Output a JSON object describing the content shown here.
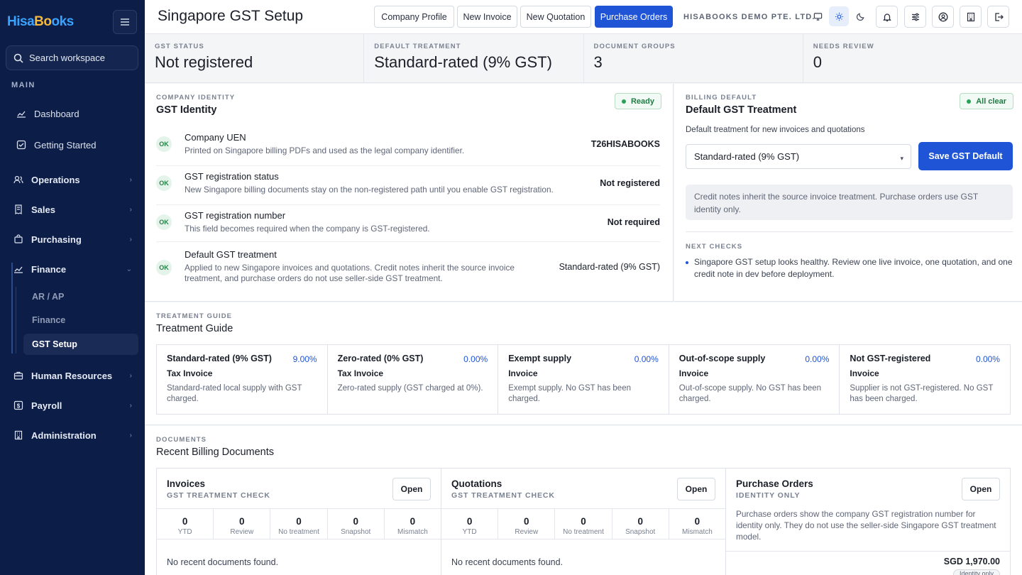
{
  "sidebar": {
    "logo_a": "Hisa",
    "logo_b": "Bo",
    "logo_c": "oks",
    "search_placeholder": "Search workspace",
    "section_main": "MAIN",
    "top_items": [
      {
        "label": "Dashboard",
        "icon": "chart-line-icon"
      },
      {
        "label": "Getting Started",
        "icon": "checkbox-icon"
      }
    ],
    "groups": [
      {
        "label": "Operations",
        "icon": "users-icon"
      },
      {
        "label": "Sales",
        "icon": "receipt-icon"
      },
      {
        "label": "Purchasing",
        "icon": "cart-icon"
      },
      {
        "label": "Finance",
        "icon": "chart-line-icon"
      },
      {
        "label": "Human Resources",
        "icon": "briefcase-icon"
      },
      {
        "label": "Payroll",
        "icon": "dollar-icon"
      },
      {
        "label": "Administration",
        "icon": "building-icon"
      }
    ],
    "finance_sub": [
      "AR / AP",
      "Finance",
      "GST Setup"
    ]
  },
  "header": {
    "title": "Singapore GST Setup",
    "buttons": [
      "Company Profile",
      "New Invoice",
      "New Quotation",
      "Purchase Orders"
    ],
    "company": "HISABOOKS DEMO PTE. LTD."
  },
  "stats": [
    {
      "label": "GST STATUS",
      "value": "Not registered"
    },
    {
      "label": "DEFAULT TREATMENT",
      "value": "Standard-rated (9% GST)"
    },
    {
      "label": "DOCUMENT GROUPS",
      "value": "3"
    },
    {
      "label": "NEEDS REVIEW",
      "value": "0"
    }
  ],
  "identity": {
    "caption": "COMPANY IDENTITY",
    "title": "GST Identity",
    "badge": "Ready",
    "ok": "OK",
    "rows": [
      {
        "title": "Company UEN",
        "desc": "Printed on Singapore billing PDFs and used as the legal company identifier.",
        "value": "T26HISABOOKS"
      },
      {
        "title": "GST registration status",
        "desc": "New Singapore billing documents stay on the non-registered path until you enable GST registration.",
        "value": "Not registered"
      },
      {
        "title": "GST registration number",
        "desc": "This field becomes required when the company is GST-registered.",
        "value": "Not required"
      },
      {
        "title": "Default GST treatment",
        "desc": "Applied to new Singapore invoices and quotations. Credit notes inherit the source invoice treatment, and purchase orders do not use seller-side GST treatment.",
        "value": "Standard-rated (9% GST)"
      }
    ]
  },
  "billing": {
    "caption": "BILLING DEFAULT",
    "title": "Default GST Treatment",
    "badge": "All clear",
    "field_label": "Default treatment for new invoices and quotations",
    "selected": "Standard-rated (9% GST)",
    "save_label": "Save GST Default",
    "note": "Credit notes inherit the source invoice treatment. Purchase orders use GST identity only.",
    "next_caption": "NEXT CHECKS",
    "next_item": "Singapore GST setup looks healthy. Review one live invoice, one quotation, and one credit note in dev before deployment."
  },
  "guide": {
    "caption": "TREATMENT GUIDE",
    "title": "Treatment Guide",
    "items": [
      {
        "name": "Standard-rated (9% GST)",
        "rate": "9.00%",
        "doc": "Tax Invoice",
        "desc": "Standard-rated local supply with GST charged."
      },
      {
        "name": "Zero-rated (0% GST)",
        "rate": "0.00%",
        "doc": "Tax Invoice",
        "desc": "Zero-rated supply (GST charged at 0%)."
      },
      {
        "name": "Exempt supply",
        "rate": "0.00%",
        "doc": "Invoice",
        "desc": "Exempt supply. No GST has been charged."
      },
      {
        "name": "Out-of-scope supply",
        "rate": "0.00%",
        "doc": "Invoice",
        "desc": "Out-of-scope supply. No GST has been charged."
      },
      {
        "name": "Not GST-registered",
        "rate": "0.00%",
        "doc": "Invoice",
        "desc": "Supplier is not GST-registered. No GST has been charged."
      }
    ]
  },
  "documents": {
    "caption": "DOCUMENTS",
    "title": "Recent Billing Documents",
    "open_label": "Open",
    "metric_labels": [
      "YTD",
      "Review",
      "No treatment",
      "Snapshot",
      "Mismatch"
    ],
    "invoices": {
      "title": "Invoices",
      "sub": "GST TREATMENT CHECK",
      "values": [
        "0",
        "0",
        "0",
        "0",
        "0"
      ],
      "empty": "No recent documents found."
    },
    "quotations": {
      "title": "Quotations",
      "sub": "GST TREATMENT CHECK",
      "values": [
        "0",
        "0",
        "0",
        "0",
        "0"
      ],
      "empty": "No recent documents found."
    },
    "purchase": {
      "title": "Purchase Orders",
      "sub": "IDENTITY ONLY",
      "desc": "Purchase orders show the company GST registration number for identity only. They do not use the seller-side Singapore GST treatment model.",
      "amount": "SGD 1,970.00",
      "chip": "Identity only"
    }
  },
  "colors": {
    "accent": "#1f54d6",
    "sidebar": "#0c1d47",
    "ok": "#27a257"
  }
}
